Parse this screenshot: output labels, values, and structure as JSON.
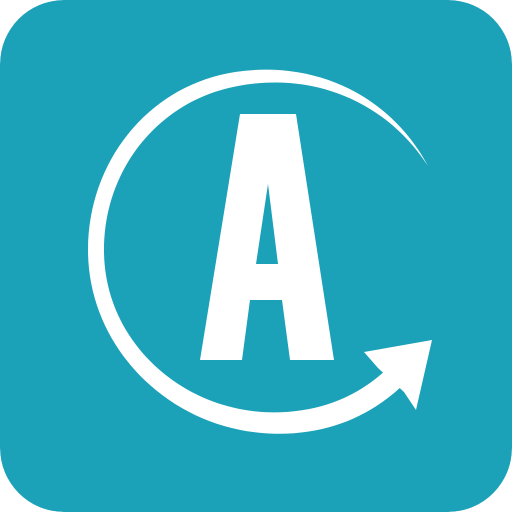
{
  "app_icon": {
    "letter": "A",
    "icon_name": "letter-a-circular-arrow-icon",
    "colors": {
      "background": "#1ba1b8",
      "foreground": "#ffffff"
    }
  }
}
